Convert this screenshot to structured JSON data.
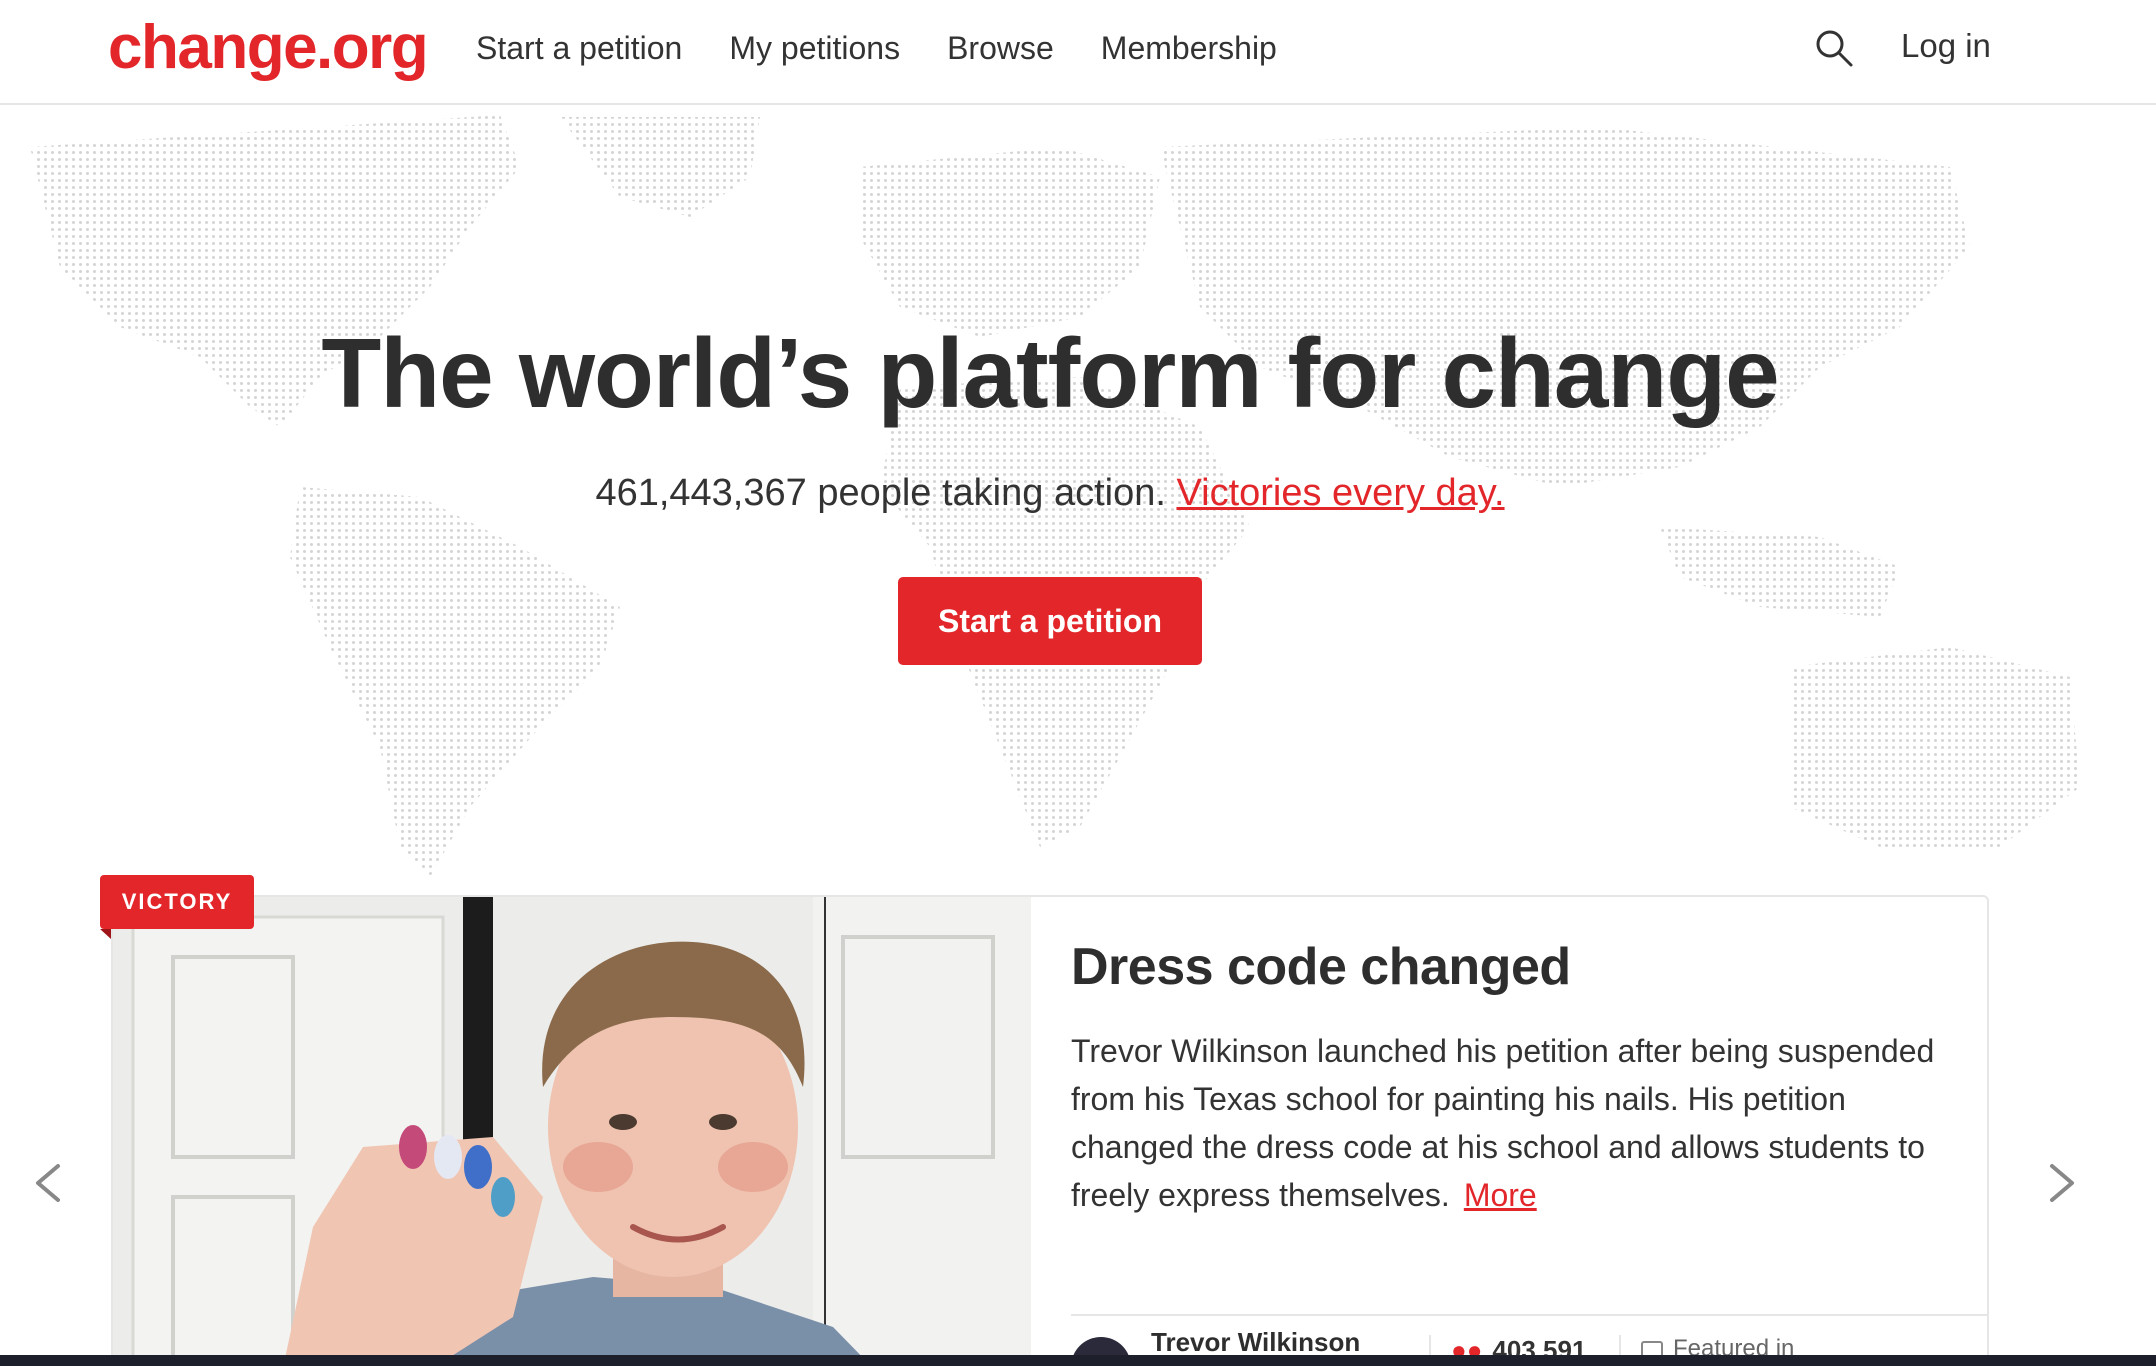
{
  "header": {
    "logo": "change.org",
    "nav": [
      "Start a petition",
      "My petitions",
      "Browse",
      "Membership"
    ],
    "search_icon": "search-icon",
    "login_label": "Log in"
  },
  "hero": {
    "title": "The world’s platform for change",
    "count": "461,443,367",
    "sub_text": " people taking action. ",
    "victories_link": "Victories every day.",
    "cta_label": "Start a petition"
  },
  "featured": {
    "badge": "VICTORY",
    "title": "Dress code changed",
    "text": "Trevor Wilkinson launched his petition after being suspended from his Texas school for painting his nails. His petition changed the dress code at his school and allows students to freely express themselves.",
    "more_label": "More",
    "author": "Trevor Wilkinson",
    "supporters": "403,591",
    "featured_in": "Featured in"
  },
  "colors": {
    "brand": "#e2262a",
    "text": "#333333",
    "border": "#e6e6e6"
  },
  "icons": {
    "prev": "chevron-left-icon",
    "next": "chevron-right-icon",
    "supporters": "people-icon"
  }
}
